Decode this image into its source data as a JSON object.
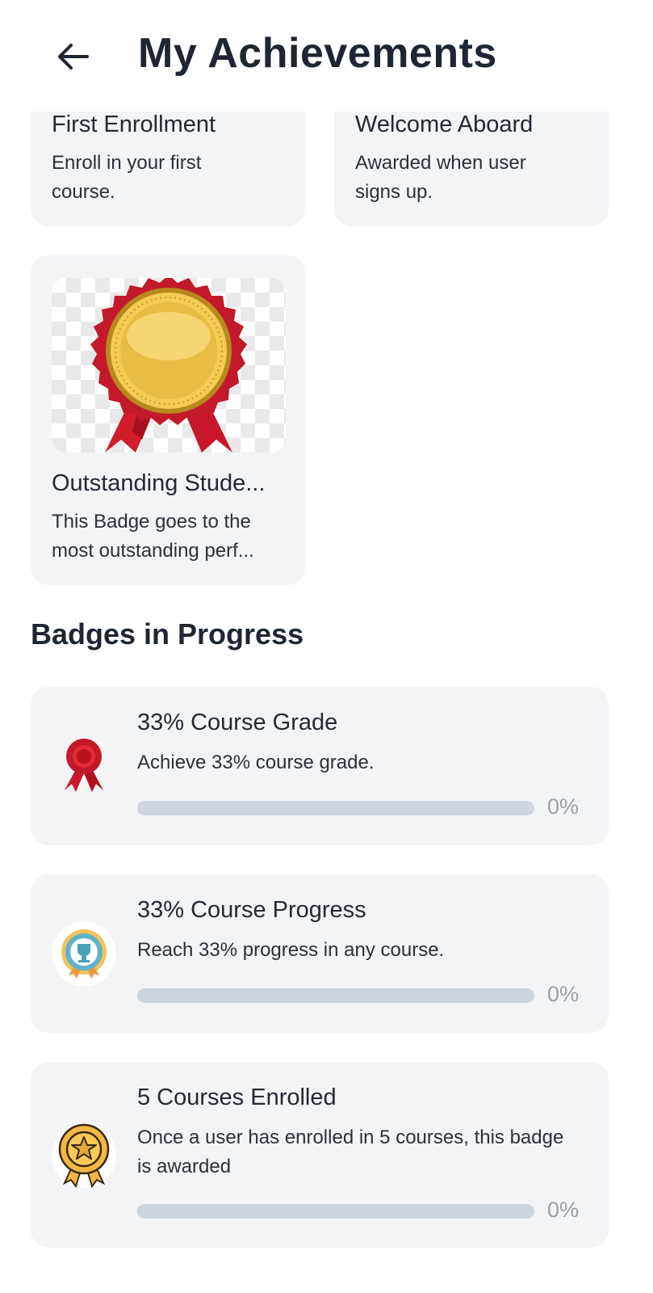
{
  "header": {
    "title": "My Achievements"
  },
  "earned": [
    {
      "title": "First Enrollment",
      "desc": "Enroll in your first course."
    },
    {
      "title": "Welcome Aboard",
      "desc": "Awarded when user signs up."
    },
    {
      "title": "Outstanding Stude...",
      "desc": "This Badge goes to the most outstanding perf...",
      "image": "gold-medal-ribbon-icon"
    }
  ],
  "progress_section": {
    "heading": "Badges in Progress",
    "items": [
      {
        "title": "33% Course Grade",
        "desc": "Achieve 33% course grade.",
        "percent_label": "0%",
        "progress": 0,
        "icon": "red-rosette-icon"
      },
      {
        "title": "33% Course Progress",
        "desc": "Reach 33% progress in any course.",
        "percent_label": "0%",
        "progress": 0,
        "icon": "trophy-badge-icon"
      },
      {
        "title": "5 Courses Enrolled",
        "desc": "Once a user has enrolled in 5 courses, this badge is awarded",
        "percent_label": "0%",
        "progress": 0,
        "icon": "star-medal-icon"
      }
    ]
  },
  "colors": {
    "card_bg": "#f3f4f6",
    "track": "#cfd5df",
    "heading": "#1e2533",
    "muted": "#9aa0a8"
  }
}
